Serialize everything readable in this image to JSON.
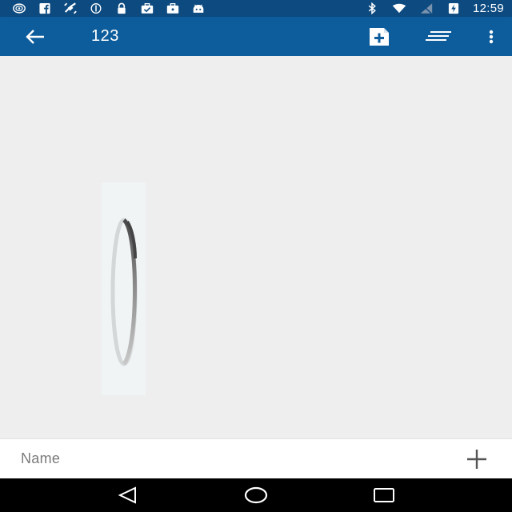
{
  "status_bar": {
    "time": "12:59",
    "left_icons": [
      "radar-icon",
      "facebook-icon",
      "satellite-icon",
      "data-saver-icon",
      "lock-icon",
      "briefcase-check-icon",
      "briefcase-icon",
      "android-icon"
    ],
    "right_icons": [
      "bluetooth-icon",
      "wifi-icon",
      "no-signal-icon",
      "battery-charging-icon"
    ],
    "color": "#0c4a80"
  },
  "toolbar": {
    "title": "123",
    "color": "#0d5d9c",
    "actions": [
      "add-note-icon",
      "sort-icon",
      "overflow-menu-icon"
    ]
  },
  "main": {
    "loading": true
  },
  "input_bar": {
    "placeholder": "Name",
    "add_icon": "plus-icon"
  },
  "nav_bar": {
    "buttons": [
      "back-triangle-icon",
      "home-circle-icon",
      "recents-square-icon"
    ]
  }
}
